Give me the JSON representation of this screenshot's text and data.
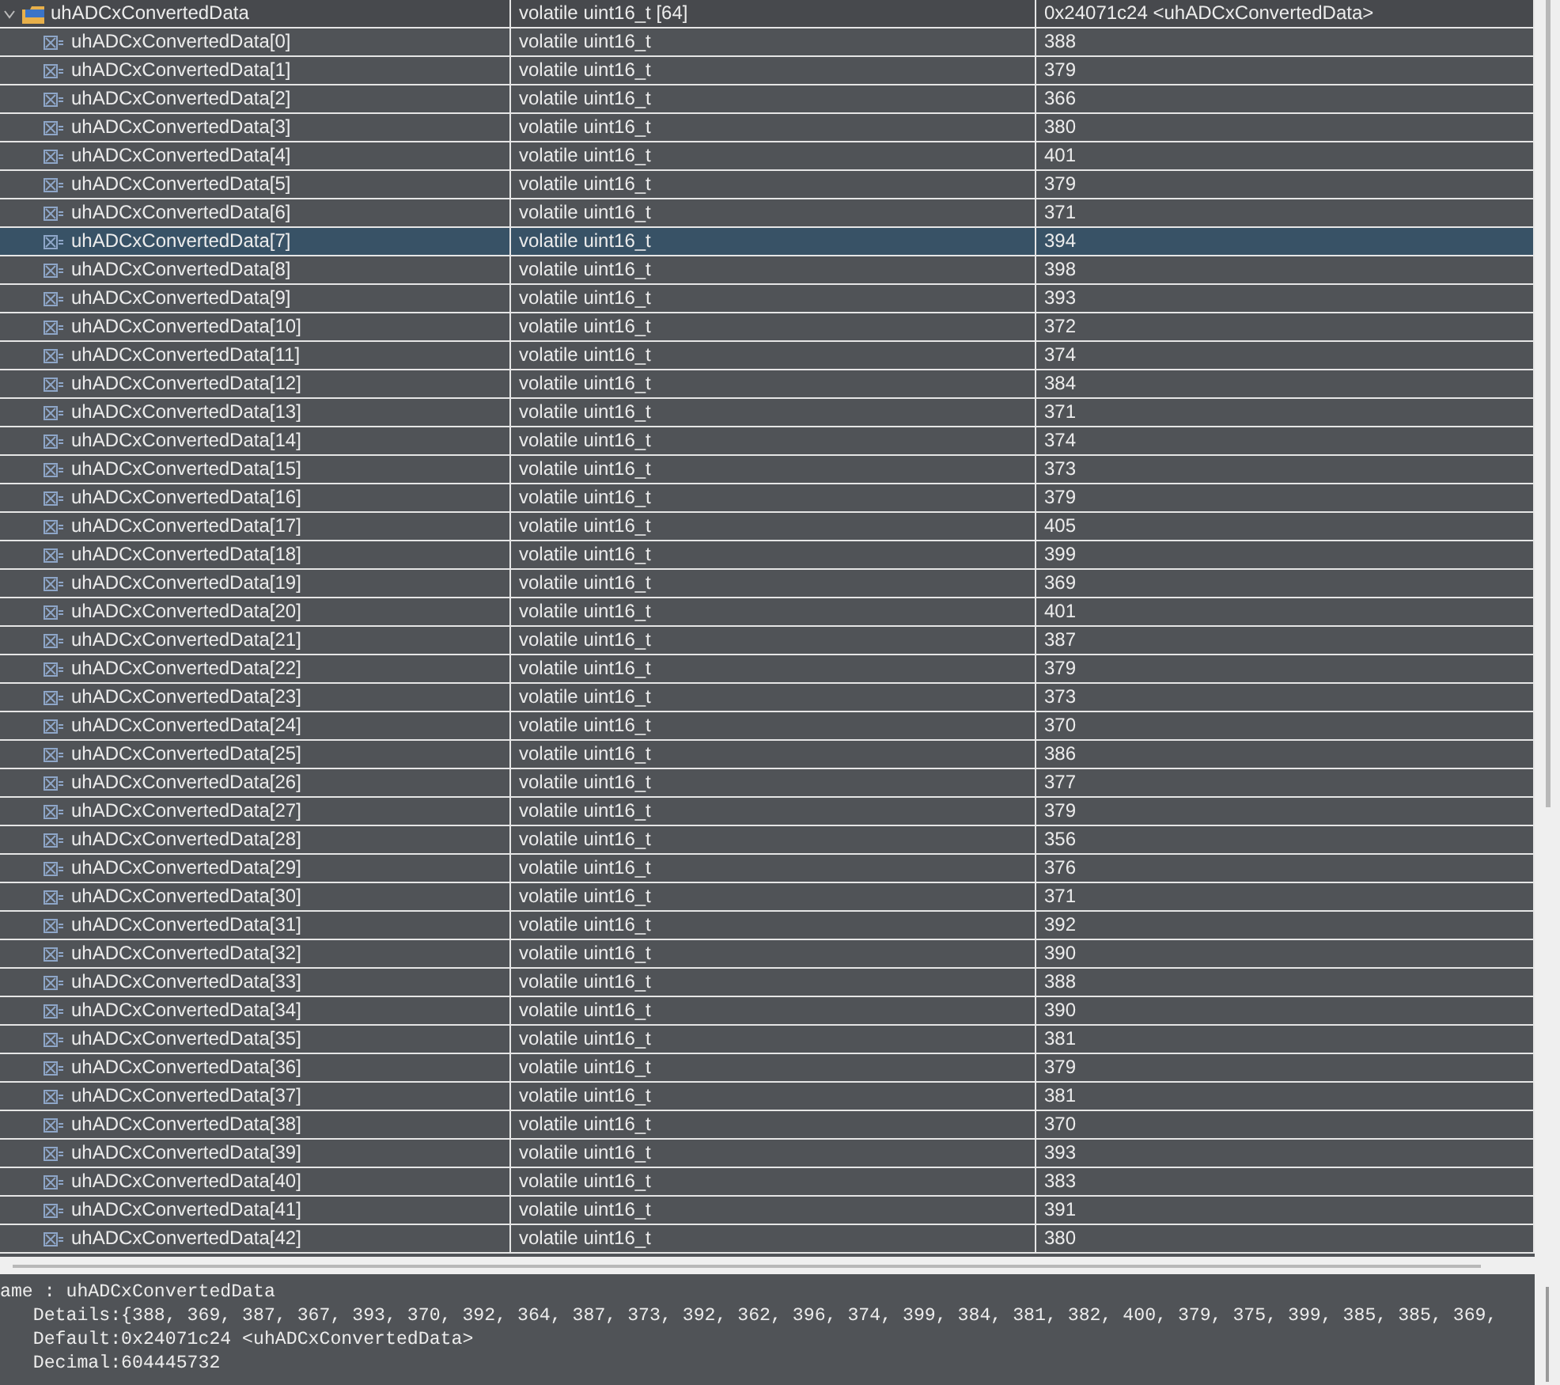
{
  "variables": {
    "root": {
      "name": "uhADCxConvertedData",
      "type": "volatile uint16_t [64]",
      "value": "0x24071c24 <uhADCxConvertedData>",
      "expanded": true
    },
    "children": [
      {
        "name": "uhADCxConvertedData[0]",
        "type": "volatile uint16_t",
        "value": "388",
        "selected": false
      },
      {
        "name": "uhADCxConvertedData[1]",
        "type": "volatile uint16_t",
        "value": "379",
        "selected": false
      },
      {
        "name": "uhADCxConvertedData[2]",
        "type": "volatile uint16_t",
        "value": "366",
        "selected": false
      },
      {
        "name": "uhADCxConvertedData[3]",
        "type": "volatile uint16_t",
        "value": "380",
        "selected": false
      },
      {
        "name": "uhADCxConvertedData[4]",
        "type": "volatile uint16_t",
        "value": "401",
        "selected": false
      },
      {
        "name": "uhADCxConvertedData[5]",
        "type": "volatile uint16_t",
        "value": "379",
        "selected": false
      },
      {
        "name": "uhADCxConvertedData[6]",
        "type": "volatile uint16_t",
        "value": "371",
        "selected": false
      },
      {
        "name": "uhADCxConvertedData[7]",
        "type": "volatile uint16_t",
        "value": "394",
        "selected": true
      },
      {
        "name": "uhADCxConvertedData[8]",
        "type": "volatile uint16_t",
        "value": "398",
        "selected": false
      },
      {
        "name": "uhADCxConvertedData[9]",
        "type": "volatile uint16_t",
        "value": "393",
        "selected": false
      },
      {
        "name": "uhADCxConvertedData[10]",
        "type": "volatile uint16_t",
        "value": "372",
        "selected": false
      },
      {
        "name": "uhADCxConvertedData[11]",
        "type": "volatile uint16_t",
        "value": "374",
        "selected": false
      },
      {
        "name": "uhADCxConvertedData[12]",
        "type": "volatile uint16_t",
        "value": "384",
        "selected": false
      },
      {
        "name": "uhADCxConvertedData[13]",
        "type": "volatile uint16_t",
        "value": "371",
        "selected": false
      },
      {
        "name": "uhADCxConvertedData[14]",
        "type": "volatile uint16_t",
        "value": "374",
        "selected": false
      },
      {
        "name": "uhADCxConvertedData[15]",
        "type": "volatile uint16_t",
        "value": "373",
        "selected": false
      },
      {
        "name": "uhADCxConvertedData[16]",
        "type": "volatile uint16_t",
        "value": "379",
        "selected": false
      },
      {
        "name": "uhADCxConvertedData[17]",
        "type": "volatile uint16_t",
        "value": "405",
        "selected": false
      },
      {
        "name": "uhADCxConvertedData[18]",
        "type": "volatile uint16_t",
        "value": "399",
        "selected": false
      },
      {
        "name": "uhADCxConvertedData[19]",
        "type": "volatile uint16_t",
        "value": "369",
        "selected": false
      },
      {
        "name": "uhADCxConvertedData[20]",
        "type": "volatile uint16_t",
        "value": "401",
        "selected": false
      },
      {
        "name": "uhADCxConvertedData[21]",
        "type": "volatile uint16_t",
        "value": "387",
        "selected": false
      },
      {
        "name": "uhADCxConvertedData[22]",
        "type": "volatile uint16_t",
        "value": "379",
        "selected": false
      },
      {
        "name": "uhADCxConvertedData[23]",
        "type": "volatile uint16_t",
        "value": "373",
        "selected": false
      },
      {
        "name": "uhADCxConvertedData[24]",
        "type": "volatile uint16_t",
        "value": "370",
        "selected": false
      },
      {
        "name": "uhADCxConvertedData[25]",
        "type": "volatile uint16_t",
        "value": "386",
        "selected": false
      },
      {
        "name": "uhADCxConvertedData[26]",
        "type": "volatile uint16_t",
        "value": "377",
        "selected": false
      },
      {
        "name": "uhADCxConvertedData[27]",
        "type": "volatile uint16_t",
        "value": "379",
        "selected": false
      },
      {
        "name": "uhADCxConvertedData[28]",
        "type": "volatile uint16_t",
        "value": "356",
        "selected": false
      },
      {
        "name": "uhADCxConvertedData[29]",
        "type": "volatile uint16_t",
        "value": "376",
        "selected": false
      },
      {
        "name": "uhADCxConvertedData[30]",
        "type": "volatile uint16_t",
        "value": "371",
        "selected": false
      },
      {
        "name": "uhADCxConvertedData[31]",
        "type": "volatile uint16_t",
        "value": "392",
        "selected": false
      },
      {
        "name": "uhADCxConvertedData[32]",
        "type": "volatile uint16_t",
        "value": "390",
        "selected": false
      },
      {
        "name": "uhADCxConvertedData[33]",
        "type": "volatile uint16_t",
        "value": "388",
        "selected": false
      },
      {
        "name": "uhADCxConvertedData[34]",
        "type": "volatile uint16_t",
        "value": "390",
        "selected": false
      },
      {
        "name": "uhADCxConvertedData[35]",
        "type": "volatile uint16_t",
        "value": "381",
        "selected": false
      },
      {
        "name": "uhADCxConvertedData[36]",
        "type": "volatile uint16_t",
        "value": "379",
        "selected": false
      },
      {
        "name": "uhADCxConvertedData[37]",
        "type": "volatile uint16_t",
        "value": "381",
        "selected": false
      },
      {
        "name": "uhADCxConvertedData[38]",
        "type": "volatile uint16_t",
        "value": "370",
        "selected": false
      },
      {
        "name": "uhADCxConvertedData[39]",
        "type": "volatile uint16_t",
        "value": "393",
        "selected": false
      },
      {
        "name": "uhADCxConvertedData[40]",
        "type": "volatile uint16_t",
        "value": "383",
        "selected": false
      },
      {
        "name": "uhADCxConvertedData[41]",
        "type": "volatile uint16_t",
        "value": "391",
        "selected": false
      },
      {
        "name": "uhADCxConvertedData[42]",
        "type": "volatile uint16_t",
        "value": "380",
        "selected": false
      }
    ]
  },
  "details": [
    "ame : uhADCxConvertedData",
    "   Details:{388, 369, 387, 367, 393, 370, 392, 364, 387, 373, 392, 362, 396, 374, 399, 384, 381, 382, 400, 379, 375, 399, 385, 385, 369,",
    "   Default:0x24071c24 <uhADCxConvertedData>",
    "   Decimal:604445732"
  ]
}
